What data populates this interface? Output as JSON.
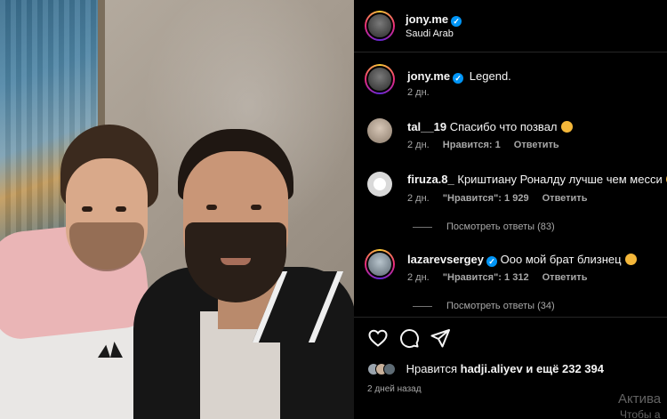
{
  "post": {
    "author": "jony.me",
    "location": "Saudi Arab",
    "caption_author": "jony.me",
    "caption": "Legend.",
    "caption_time": "2 дн."
  },
  "comments": [
    {
      "user": "tal__19",
      "text": "Спасибо что позвал",
      "emoji": "grinning-emoji",
      "time": "2 дн.",
      "likes": "Нравится: 1",
      "reply": "Ответить"
    },
    {
      "user": "firuza.8_",
      "text": "Криштиану Роналду лучше чем месси",
      "emoji": "grin-sweat-emoji",
      "time": "2 дн.",
      "likes": "\"Нравится\": 1 929",
      "reply": "Ответить",
      "view_replies": "Посмотреть ответы (83)"
    },
    {
      "user": "lazarevsergey",
      "verified": true,
      "text": "Ооо мой брат близнец",
      "emoji": "laughing-emoji",
      "time": "2 дн.",
      "likes": "\"Нравится\": 1 312",
      "reply": "Ответить",
      "view_replies": "Посмотреть ответы (34)"
    }
  ],
  "actions": {
    "like": "heart-icon",
    "comment": "comment-icon",
    "share": "send-icon"
  },
  "likes_summary": {
    "prefix": "Нравится",
    "user": "hadji.aliyev",
    "suffix": "и ещё 232 394"
  },
  "posted_time": "2 дней назад",
  "watermark": {
    "line1": "Актива",
    "line2": "Чтобы а"
  },
  "colors": {
    "verified": "#0095f6",
    "background": "#000000",
    "secondary_text": "#a8a8a8"
  }
}
